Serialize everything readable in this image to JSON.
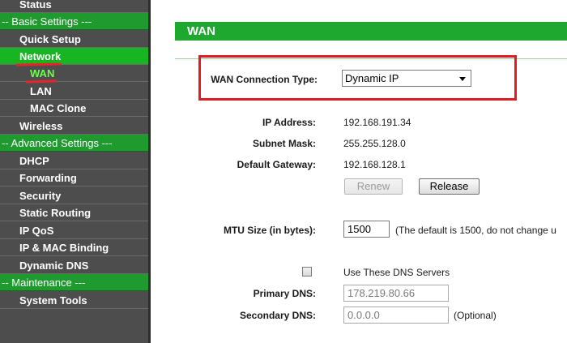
{
  "sidebar": {
    "items": [
      {
        "label": "Status",
        "kind": "item",
        "top": 0
      },
      {
        "label": "-- Basic Settings ---",
        "kind": "section"
      },
      {
        "label": "Quick Setup",
        "kind": "item"
      },
      {
        "label": "Network",
        "kind": "item",
        "active": true
      },
      {
        "label": "WAN",
        "kind": "sub",
        "selected": true
      },
      {
        "label": "LAN",
        "kind": "sub"
      },
      {
        "label": "MAC Clone",
        "kind": "sub"
      },
      {
        "label": "Wireless",
        "kind": "item"
      },
      {
        "label": "-- Advanced Settings ---",
        "kind": "section"
      },
      {
        "label": "DHCP",
        "kind": "item"
      },
      {
        "label": "Forwarding",
        "kind": "item"
      },
      {
        "label": "Security",
        "kind": "item"
      },
      {
        "label": "Static Routing",
        "kind": "item"
      },
      {
        "label": "IP QoS",
        "kind": "item"
      },
      {
        "label": "IP & MAC Binding",
        "kind": "item"
      },
      {
        "label": "Dynamic DNS",
        "kind": "item"
      },
      {
        "label": "-- Maintenance ---",
        "kind": "section"
      },
      {
        "label": "System Tools",
        "kind": "item"
      }
    ]
  },
  "page": {
    "title": "WAN"
  },
  "wan": {
    "connection_type_label": "WAN Connection Type:",
    "connection_type_value": "Dynamic IP",
    "ip_label": "IP Address:",
    "ip_value": "192.168.191.34",
    "mask_label": "Subnet Mask:",
    "mask_value": "255.255.128.0",
    "gateway_label": "Default Gateway:",
    "gateway_value": "192.168.128.1",
    "renew_label": "Renew",
    "release_label": "Release",
    "mtu_label": "MTU Size (in bytes):",
    "mtu_value": "1500",
    "mtu_note": "(The default is 1500, do not change u",
    "dns_checkbox_label": "Use These DNS Servers",
    "primary_dns_label": "Primary DNS:",
    "primary_dns_value": "178.219.80.66",
    "secondary_dns_label": "Secondary DNS:",
    "secondary_dns_value": "0.0.0.0",
    "secondary_dns_note": "(Optional)"
  },
  "colors": {
    "sidebar_bg": "#4d4d4d",
    "section_green": "#1f9a2f",
    "active_green": "#17b521",
    "title_green": "#1fa82f",
    "highlight_red": "#e11b22"
  }
}
